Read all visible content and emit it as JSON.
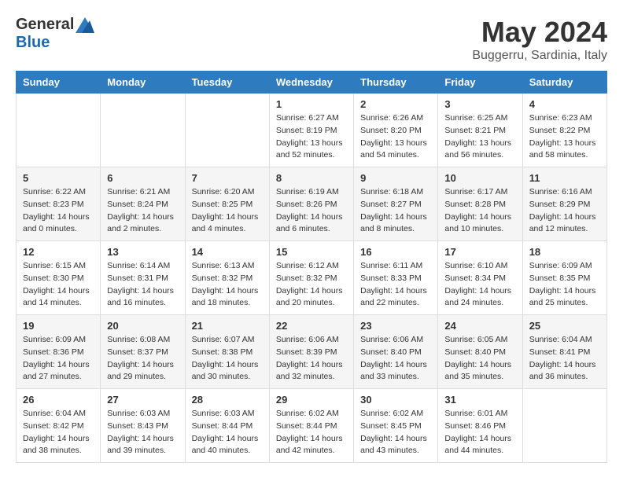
{
  "header": {
    "logo_general": "General",
    "logo_blue": "Blue",
    "month_title": "May 2024",
    "location": "Buggerru, Sardinia, Italy"
  },
  "days_of_week": [
    "Sunday",
    "Monday",
    "Tuesday",
    "Wednesday",
    "Thursday",
    "Friday",
    "Saturday"
  ],
  "weeks": [
    {
      "days": [
        {
          "number": "",
          "info": ""
        },
        {
          "number": "",
          "info": ""
        },
        {
          "number": "",
          "info": ""
        },
        {
          "number": "1",
          "info": "Sunrise: 6:27 AM\nSunset: 8:19 PM\nDaylight: 13 hours and 52 minutes."
        },
        {
          "number": "2",
          "info": "Sunrise: 6:26 AM\nSunset: 8:20 PM\nDaylight: 13 hours and 54 minutes."
        },
        {
          "number": "3",
          "info": "Sunrise: 6:25 AM\nSunset: 8:21 PM\nDaylight: 13 hours and 56 minutes."
        },
        {
          "number": "4",
          "info": "Sunrise: 6:23 AM\nSunset: 8:22 PM\nDaylight: 13 hours and 58 minutes."
        }
      ]
    },
    {
      "days": [
        {
          "number": "5",
          "info": "Sunrise: 6:22 AM\nSunset: 8:23 PM\nDaylight: 14 hours and 0 minutes."
        },
        {
          "number": "6",
          "info": "Sunrise: 6:21 AM\nSunset: 8:24 PM\nDaylight: 14 hours and 2 minutes."
        },
        {
          "number": "7",
          "info": "Sunrise: 6:20 AM\nSunset: 8:25 PM\nDaylight: 14 hours and 4 minutes."
        },
        {
          "number": "8",
          "info": "Sunrise: 6:19 AM\nSunset: 8:26 PM\nDaylight: 14 hours and 6 minutes."
        },
        {
          "number": "9",
          "info": "Sunrise: 6:18 AM\nSunset: 8:27 PM\nDaylight: 14 hours and 8 minutes."
        },
        {
          "number": "10",
          "info": "Sunrise: 6:17 AM\nSunset: 8:28 PM\nDaylight: 14 hours and 10 minutes."
        },
        {
          "number": "11",
          "info": "Sunrise: 6:16 AM\nSunset: 8:29 PM\nDaylight: 14 hours and 12 minutes."
        }
      ]
    },
    {
      "days": [
        {
          "number": "12",
          "info": "Sunrise: 6:15 AM\nSunset: 8:30 PM\nDaylight: 14 hours and 14 minutes."
        },
        {
          "number": "13",
          "info": "Sunrise: 6:14 AM\nSunset: 8:31 PM\nDaylight: 14 hours and 16 minutes."
        },
        {
          "number": "14",
          "info": "Sunrise: 6:13 AM\nSunset: 8:32 PM\nDaylight: 14 hours and 18 minutes."
        },
        {
          "number": "15",
          "info": "Sunrise: 6:12 AM\nSunset: 8:32 PM\nDaylight: 14 hours and 20 minutes."
        },
        {
          "number": "16",
          "info": "Sunrise: 6:11 AM\nSunset: 8:33 PM\nDaylight: 14 hours and 22 minutes."
        },
        {
          "number": "17",
          "info": "Sunrise: 6:10 AM\nSunset: 8:34 PM\nDaylight: 14 hours and 24 minutes."
        },
        {
          "number": "18",
          "info": "Sunrise: 6:09 AM\nSunset: 8:35 PM\nDaylight: 14 hours and 25 minutes."
        }
      ]
    },
    {
      "days": [
        {
          "number": "19",
          "info": "Sunrise: 6:09 AM\nSunset: 8:36 PM\nDaylight: 14 hours and 27 minutes."
        },
        {
          "number": "20",
          "info": "Sunrise: 6:08 AM\nSunset: 8:37 PM\nDaylight: 14 hours and 29 minutes."
        },
        {
          "number": "21",
          "info": "Sunrise: 6:07 AM\nSunset: 8:38 PM\nDaylight: 14 hours and 30 minutes."
        },
        {
          "number": "22",
          "info": "Sunrise: 6:06 AM\nSunset: 8:39 PM\nDaylight: 14 hours and 32 minutes."
        },
        {
          "number": "23",
          "info": "Sunrise: 6:06 AM\nSunset: 8:40 PM\nDaylight: 14 hours and 33 minutes."
        },
        {
          "number": "24",
          "info": "Sunrise: 6:05 AM\nSunset: 8:40 PM\nDaylight: 14 hours and 35 minutes."
        },
        {
          "number": "25",
          "info": "Sunrise: 6:04 AM\nSunset: 8:41 PM\nDaylight: 14 hours and 36 minutes."
        }
      ]
    },
    {
      "days": [
        {
          "number": "26",
          "info": "Sunrise: 6:04 AM\nSunset: 8:42 PM\nDaylight: 14 hours and 38 minutes."
        },
        {
          "number": "27",
          "info": "Sunrise: 6:03 AM\nSunset: 8:43 PM\nDaylight: 14 hours and 39 minutes."
        },
        {
          "number": "28",
          "info": "Sunrise: 6:03 AM\nSunset: 8:44 PM\nDaylight: 14 hours and 40 minutes."
        },
        {
          "number": "29",
          "info": "Sunrise: 6:02 AM\nSunset: 8:44 PM\nDaylight: 14 hours and 42 minutes."
        },
        {
          "number": "30",
          "info": "Sunrise: 6:02 AM\nSunset: 8:45 PM\nDaylight: 14 hours and 43 minutes."
        },
        {
          "number": "31",
          "info": "Sunrise: 6:01 AM\nSunset: 8:46 PM\nDaylight: 14 hours and 44 minutes."
        },
        {
          "number": "",
          "info": ""
        }
      ]
    }
  ]
}
